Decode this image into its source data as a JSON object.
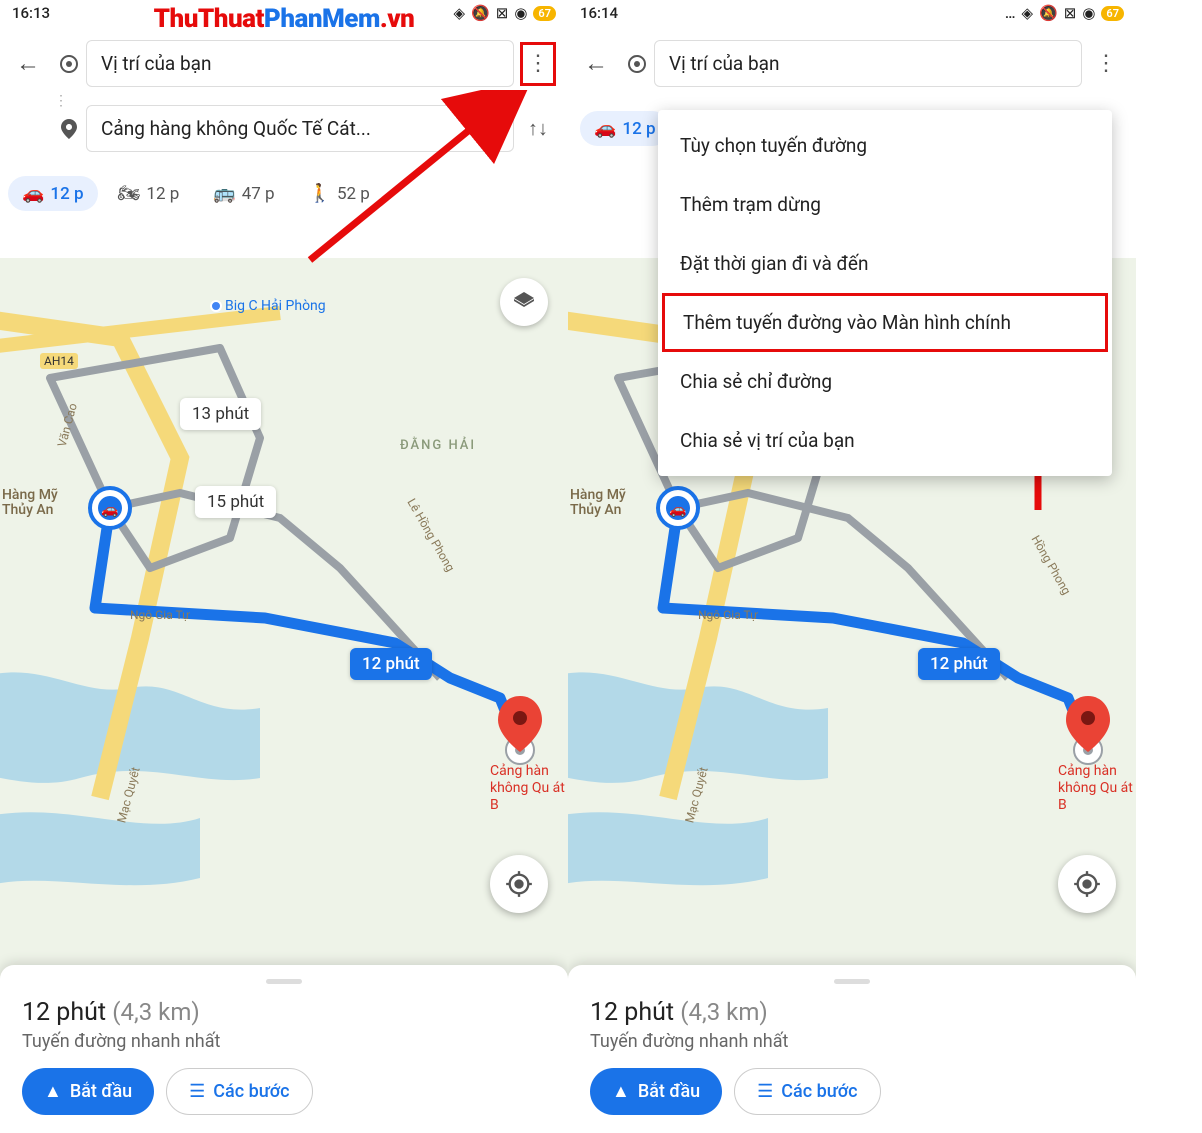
{
  "watermark": {
    "part1": "ThuThuat",
    "part2": "PhanMem",
    "part3": ".vn"
  },
  "left": {
    "status_time": "16:13",
    "battery": "67",
    "origin": "Vị trí của bạn",
    "destination": "Cảng hàng không Quốc Tế Cát...",
    "modes": {
      "car": "12 p",
      "moto": "12 p",
      "bus": "47 p",
      "walk": "52 p"
    },
    "map": {
      "poi_bigc": "Big C Hải Phòng",
      "district": "ĐẰNG HẢI",
      "alt1": "13 phút",
      "alt2": "15 phút",
      "main": "12 phút",
      "road_ah14": "AH14",
      "road_vancao": "Văn Cao",
      "road_ngogiat": "Ngô Gia Tự",
      "road_lehong": "Lê Hồng Phong",
      "road_macquyet": "Mạc Quyết",
      "origin_label": "Hàng Mỹ Thủy An",
      "dest_label": "Cảng hàn không Qu át B"
    },
    "sheet": {
      "time": "12 phút",
      "dist": "(4,3 km)",
      "sub": "Tuyến đường nhanh nhất",
      "start": "Bắt đầu",
      "steps": "Các bước"
    }
  },
  "right": {
    "status_time": "16:14",
    "battery": "67",
    "origin": "Vị trí của bạn",
    "modes": {
      "car": "12 p"
    },
    "menu": {
      "opt1": "Tùy chọn tuyến đường",
      "opt2": "Thêm trạm dừng",
      "opt3": "Đặt thời gian đi và đến",
      "opt4": "Thêm tuyến đường vào Màn hình chính",
      "opt5": "Chia sẻ chỉ đường",
      "opt6": "Chia sẻ vị trí của bạn"
    },
    "map": {
      "main": "12 phút",
      "road_ngogiat": "Ngô Gia Tự",
      "road_lehong": "Hồng Phong",
      "road_macquyet": "Mạc Quyết",
      "origin_label": "Hàng Mỹ Thủy An",
      "dest_label": "Cảng hàn không Qu át B"
    },
    "sheet": {
      "time": "12 phút",
      "dist": "(4,3 km)",
      "sub": "Tuyến đường nhanh nhất",
      "start": "Bắt đầu",
      "steps": "Các bước"
    }
  }
}
